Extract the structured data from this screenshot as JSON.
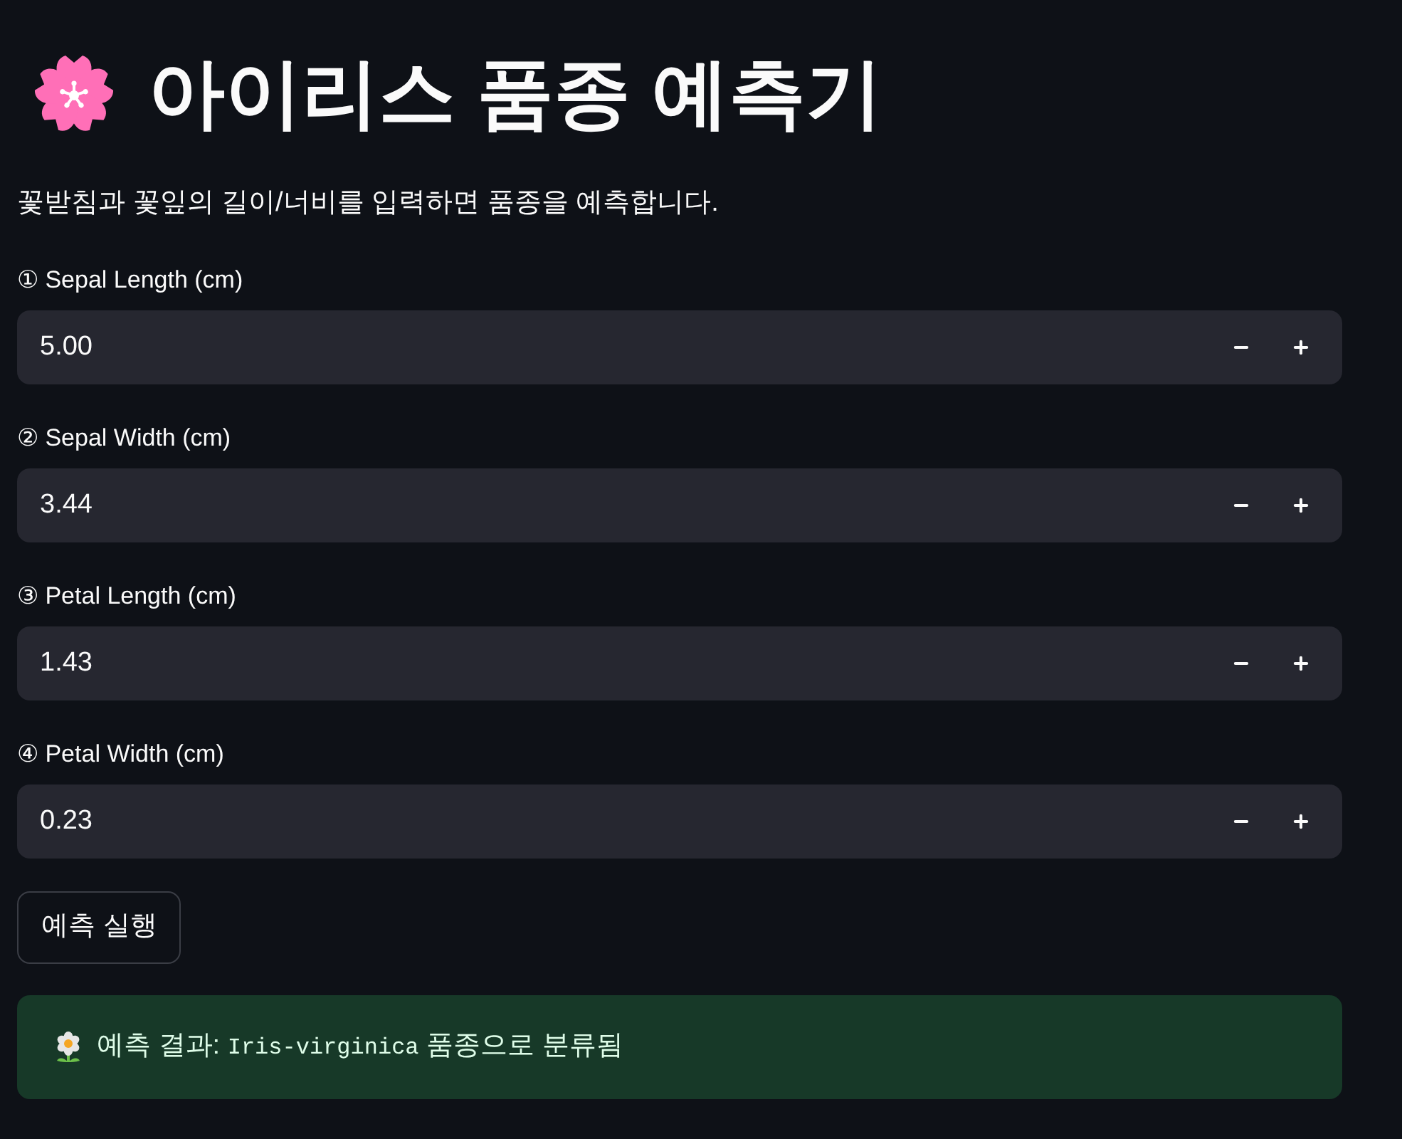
{
  "title": {
    "text": "아이리스 품종 예측기"
  },
  "description": "꽃받침과 꽃잎의 길이/너비를 입력하면 품종을 예측합니다.",
  "fields": [
    {
      "label": "① Sepal Length (cm)",
      "value": "5.00"
    },
    {
      "label": "② Sepal Width (cm)",
      "value": "3.44"
    },
    {
      "label": "③ Petal Length (cm)",
      "value": "1.43"
    },
    {
      "label": "④ Petal Width (cm)",
      "value": "0.23"
    }
  ],
  "predict_button": {
    "label": "예측 실행"
  },
  "result": {
    "kind": "success",
    "prefix": "예측 결과: ",
    "code": "Iris-virginica",
    "suffix": " 품종으로 분류됨"
  }
}
